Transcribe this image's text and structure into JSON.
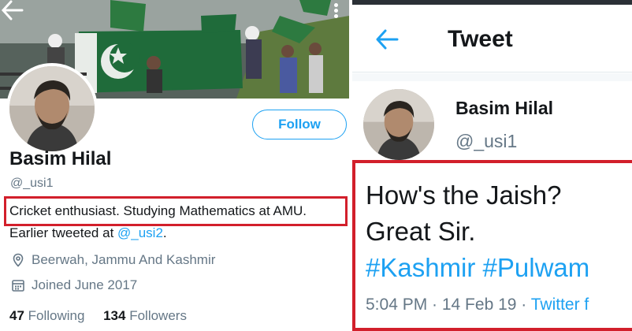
{
  "profile": {
    "name": "Basim Hilal",
    "handle": "@_usi1",
    "follow_label": "Follow",
    "bio_line1": "Cricket enthusiast. Studying Mathematics at AMU.",
    "bio_prefix": "Earlier tweeted at ",
    "bio_link": "@_usi2",
    "bio_suffix": ".",
    "location": "Beerwah, Jammu And Kashmir",
    "joined": "Joined June 2017",
    "following_count": "47",
    "following_label": "Following",
    "followers_count": "134",
    "followers_label": "Followers"
  },
  "tweet_view": {
    "header_title": "Tweet",
    "author_name": "Basim Hilal",
    "author_handle": "@_usi1",
    "text_line1": "How's the Jaish?",
    "text_line2": "Great Sir.",
    "hashtags": "#Kashmir #Pulwam",
    "time": "5:04 PM · 14 Feb 19 · ",
    "source": "Twitter f"
  },
  "icons": {
    "back": "arrow-left-icon",
    "more": "more-vertical-icon",
    "location": "location-pin-icon",
    "calendar": "calendar-icon"
  },
  "colors": {
    "accent": "#1da1f2",
    "highlight_box": "#d21f2b",
    "text": "#14171a",
    "muted": "#657786"
  }
}
